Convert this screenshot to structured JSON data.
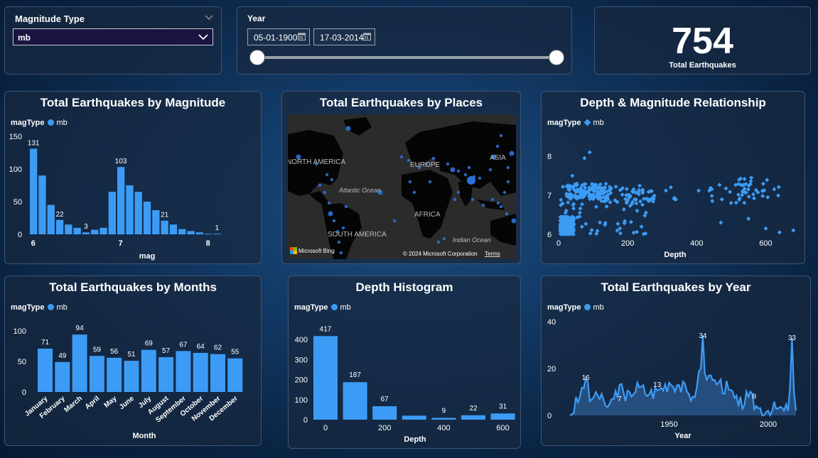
{
  "filters": {
    "magnitude_type": {
      "label": "Magnitude Type",
      "selected": "mb"
    },
    "year": {
      "label": "Year",
      "start_date": "05-01-1900",
      "end_date": "17-03-2014",
      "slider_start": 0,
      "slider_end": 1
    }
  },
  "kpi": {
    "value": "754",
    "label": "Total Earthquakes"
  },
  "legend": {
    "title": "magType",
    "series": "mb"
  },
  "colors": {
    "series": "#3c9cf5",
    "card": "#18283f",
    "map_bg": "#2b2b2b",
    "land": "#050505"
  },
  "charts": {
    "magnitude": {
      "title": "Total Earthquakes by Magnitude",
      "xlabel": "mag",
      "ylabel": "",
      "type": "bar",
      "x": [
        "6",
        "7",
        "8"
      ],
      "ylim": [
        0,
        150
      ],
      "values": [
        131,
        90,
        45,
        22,
        15,
        10,
        3,
        7,
        10,
        65,
        103,
        75,
        65,
        50,
        37,
        21,
        15,
        8,
        5,
        3,
        1,
        1
      ],
      "yticks": [
        "0",
        "50",
        "100",
        "150"
      ],
      "labels": [
        {
          "i": 0,
          "v": "131"
        },
        {
          "i": 3,
          "v": "22"
        },
        {
          "i": 6,
          "v": "3"
        },
        {
          "i": 10,
          "v": "103"
        },
        {
          "i": 15,
          "v": "21"
        },
        {
          "i": 21,
          "v": "1"
        }
      ]
    },
    "places": {
      "title": "Total Earthquakes by Places",
      "type": "map",
      "labels": [
        "NORTH AMERICA",
        "EUROPE",
        "ASIA",
        "Atlantic Ocean",
        "AFRICA",
        "SOUTH AMERICA",
        "Indian Ocean"
      ],
      "credit_left": "Microsoft Bing",
      "credit_right": "© 2024 Microsoft Corporation",
      "terms": "Terms"
    },
    "depth_mag": {
      "title": "Depth & Magnitude Relationship",
      "type": "scatter",
      "xlabel": "Depth",
      "xticks": [
        "0",
        "200",
        "400",
        "600"
      ],
      "yticks": [
        "6",
        "7",
        "8"
      ],
      "xlim": [
        0,
        700
      ],
      "ylim": [
        5.9,
        8.3
      ]
    },
    "months": {
      "title": "Total Earthquakes by Months",
      "type": "bar",
      "xlabel": "Month",
      "categories": [
        "January",
        "February",
        "March",
        "April",
        "May",
        "June",
        "July",
        "August",
        "September",
        "October",
        "November",
        "December"
      ],
      "values": [
        71,
        49,
        94,
        59,
        56,
        51,
        69,
        57,
        67,
        64,
        62,
        55
      ],
      "yticks": [
        "0",
        "50",
        "100"
      ],
      "ylim": [
        0,
        100
      ]
    },
    "depth_hist": {
      "title": "Depth Histogram",
      "type": "bar",
      "xlabel": "Depth",
      "values": [
        417,
        187,
        67,
        20,
        9,
        22,
        31
      ],
      "labels": [
        "417",
        "187",
        "67",
        "",
        "9",
        "22",
        "31"
      ],
      "xticks": [
        "0",
        "200",
        "400",
        "600"
      ],
      "yticks": [
        "0",
        "100",
        "200",
        "300",
        "400"
      ],
      "ylim": [
        0,
        450
      ]
    },
    "year": {
      "title": "Total Earthquakes by Year",
      "type": "area",
      "xlabel": "Year",
      "xticks": [
        "1950",
        "2000"
      ],
      "yticks": [
        "0",
        "20",
        "40"
      ],
      "ylim": [
        0,
        40
      ],
      "labels": [
        "16",
        "7",
        "13",
        "34",
        "8",
        "33"
      ]
    }
  },
  "chart_data": [
    {
      "type": "bar",
      "title": "Total Earthquakes by Magnitude",
      "xlabel": "mag",
      "ylim": [
        0,
        150
      ],
      "x": [
        6.0,
        6.1,
        6.2,
        6.3,
        6.4,
        6.5,
        6.6,
        6.7,
        6.8,
        6.9,
        7.0,
        7.1,
        7.2,
        7.3,
        7.4,
        7.5,
        7.6,
        7.7,
        7.8,
        7.9,
        8.0,
        8.1
      ],
      "values": [
        131,
        90,
        45,
        22,
        15,
        10,
        3,
        7,
        10,
        65,
        103,
        75,
        65,
        50,
        37,
        21,
        15,
        8,
        5,
        3,
        1,
        1
      ]
    },
    {
      "type": "scatter",
      "title": "Depth & Magnitude Relationship",
      "xlabel": "Depth",
      "xlim": [
        0,
        700
      ],
      "ylim": [
        5.9,
        8.3
      ]
    },
    {
      "type": "bar",
      "title": "Total Earthquakes by Months",
      "xlabel": "Month",
      "categories": [
        "January",
        "February",
        "March",
        "April",
        "May",
        "June",
        "July",
        "August",
        "September",
        "October",
        "November",
        "December"
      ],
      "values": [
        71,
        49,
        94,
        59,
        56,
        51,
        69,
        57,
        67,
        64,
        62,
        55
      ]
    },
    {
      "type": "bar",
      "title": "Depth Histogram",
      "xlabel": "Depth",
      "x": [
        0,
        100,
        200,
        300,
        400,
        500,
        600
      ],
      "values": [
        417,
        187,
        67,
        20,
        9,
        22,
        31
      ]
    },
    {
      "type": "area",
      "title": "Total Earthquakes by Year",
      "xlabel": "Year",
      "ylim": [
        0,
        40
      ],
      "x": [
        1900,
        1905,
        1908,
        1910,
        1913,
        1915,
        1918,
        1920,
        1922,
        1925,
        1928,
        1930,
        1935,
        1940,
        1945,
        1950,
        1955,
        1960,
        1962,
        1964,
        1966,
        1967,
        1968,
        1970,
        1972,
        1975,
        1980,
        1985,
        1990,
        1995,
        2000,
        2005,
        2008,
        2010,
        2011,
        2012,
        2013,
        2014
      ],
      "values": [
        0,
        8,
        16,
        6,
        10,
        7,
        4,
        5,
        7,
        13,
        6,
        10,
        12,
        9,
        11,
        14,
        13,
        9,
        8,
        12,
        20,
        34,
        18,
        17,
        15,
        14,
        11,
        4,
        8,
        3,
        2,
        3,
        2,
        2,
        12,
        33,
        10,
        2
      ]
    }
  ]
}
